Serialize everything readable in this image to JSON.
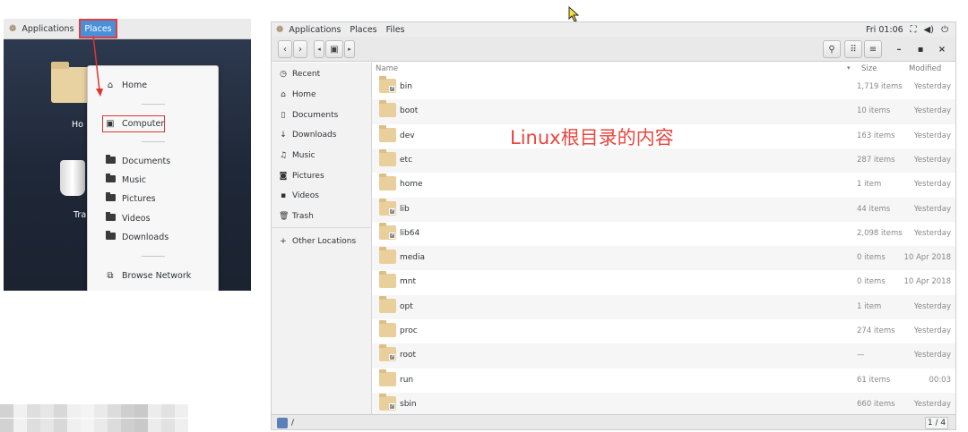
{
  "left_panel": {
    "topbar": {
      "applications": "Applications",
      "places": "Places"
    },
    "desktop": {
      "home_label": "Ho",
      "trash_label": "Tra"
    },
    "places_menu": {
      "items": [
        {
          "label": "Home",
          "icon": "home-icon"
        },
        {
          "label": "Computer",
          "icon": "computer-icon"
        },
        {
          "label": "Documents",
          "icon": "folder-icon"
        },
        {
          "label": "Music",
          "icon": "folder-icon"
        },
        {
          "label": "Pictures",
          "icon": "folder-icon"
        },
        {
          "label": "Videos",
          "icon": "folder-icon"
        },
        {
          "label": "Downloads",
          "icon": "folder-icon"
        },
        {
          "label": "Browse Network",
          "icon": "network-icon"
        }
      ]
    }
  },
  "files_window": {
    "topbar": {
      "applications": "Applications",
      "places": "Places",
      "files": "Files",
      "clock": "Fri 01:06"
    },
    "sidebar": [
      {
        "label": "Recent",
        "icon": "clock-icon"
      },
      {
        "label": "Home",
        "icon": "home-icon"
      },
      {
        "label": "Documents",
        "icon": "document-icon"
      },
      {
        "label": "Downloads",
        "icon": "download-icon"
      },
      {
        "label": "Music",
        "icon": "music-icon"
      },
      {
        "label": "Pictures",
        "icon": "camera-icon"
      },
      {
        "label": "Videos",
        "icon": "video-icon"
      },
      {
        "label": "Trash",
        "icon": "trash-icon"
      },
      {
        "label": "Other Locations",
        "icon": "plus-icon"
      }
    ],
    "columns": {
      "name": "Name",
      "size": "Size",
      "modified": "Modified"
    },
    "rows": [
      {
        "name": "bin",
        "size": "1,719 items",
        "modified": "Yesterday",
        "link": true
      },
      {
        "name": "boot",
        "size": "10 items",
        "modified": "Yesterday",
        "link": false
      },
      {
        "name": "dev",
        "size": "163 items",
        "modified": "Yesterday",
        "link": false
      },
      {
        "name": "etc",
        "size": "287 items",
        "modified": "Yesterday",
        "link": false
      },
      {
        "name": "home",
        "size": "1 item",
        "modified": "Yesterday",
        "link": false
      },
      {
        "name": "lib",
        "size": "44 items",
        "modified": "Yesterday",
        "link": true
      },
      {
        "name": "lib64",
        "size": "2,098 items",
        "modified": "Yesterday",
        "link": true
      },
      {
        "name": "media",
        "size": "0 items",
        "modified": "10 Apr 2018",
        "link": false
      },
      {
        "name": "mnt",
        "size": "0 items",
        "modified": "10 Apr 2018",
        "link": false
      },
      {
        "name": "opt",
        "size": "1 item",
        "modified": "Yesterday",
        "link": false
      },
      {
        "name": "proc",
        "size": "274 items",
        "modified": "Yesterday",
        "link": false
      },
      {
        "name": "root",
        "size": "—",
        "modified": "Yesterday",
        "link": true
      },
      {
        "name": "run",
        "size": "61 items",
        "modified": "00:03",
        "link": false
      },
      {
        "name": "sbin",
        "size": "660 items",
        "modified": "Yesterday",
        "link": true
      }
    ],
    "annotation": "Linux根目录的内容",
    "statusbar": {
      "path": "/",
      "page": "1 / 4"
    }
  },
  "colors": {
    "accent": "#4a90d9",
    "annotation_red": "#e8463f",
    "folder": "#e9cf9c"
  }
}
